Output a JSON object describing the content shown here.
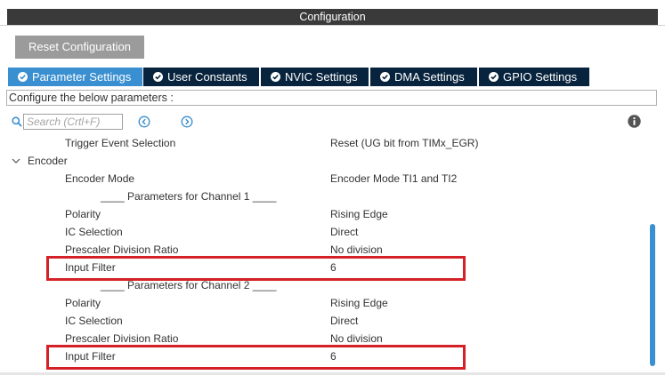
{
  "header": {
    "title": "Configuration"
  },
  "toolbar": {
    "reset_label": "Reset Configuration"
  },
  "tabs": [
    {
      "label": "Parameter Settings",
      "active": true
    },
    {
      "label": "User Constants",
      "active": false
    },
    {
      "label": "NVIC Settings",
      "active": false
    },
    {
      "label": "DMA Settings",
      "active": false
    },
    {
      "label": "GPIO Settings",
      "active": false
    }
  ],
  "description": "Configure the below parameters :",
  "search": {
    "placeholder": "Search (Crtl+F)",
    "value": ""
  },
  "params": {
    "trigger_event_selection": {
      "name": "Trigger Event Selection",
      "value": "Reset (UG bit from TIMx_EGR)"
    },
    "encoder_group": "Encoder",
    "encoder_mode": {
      "name": "Encoder Mode",
      "value": "Encoder Mode TI1 and TI2"
    },
    "channel1_header": "____ Parameters for Channel 1 ____",
    "ch1_polarity": {
      "name": "Polarity",
      "value": "Rising Edge"
    },
    "ch1_ic_selection": {
      "name": "IC Selection",
      "value": "Direct"
    },
    "ch1_prescaler": {
      "name": "Prescaler Division Ratio",
      "value": "No division"
    },
    "ch1_input_filter": {
      "name": "Input Filter",
      "value": "6"
    },
    "channel2_header": "____ Parameters for Channel 2 ____",
    "ch2_polarity": {
      "name": "Polarity",
      "value": "Rising Edge"
    },
    "ch2_ic_selection": {
      "name": "IC Selection",
      "value": "Direct"
    },
    "ch2_prescaler": {
      "name": "Prescaler Division Ratio",
      "value": "No division"
    },
    "ch2_input_filter": {
      "name": "Input Filter",
      "value": "6"
    }
  },
  "colors": {
    "active_tab": "#3a8fd0",
    "inactive_tab": "#08233d",
    "highlight": "#d42027",
    "reset_button": "#9b9b9b"
  },
  "icons": [
    "check-circle-icon",
    "search-icon",
    "prev-arrow-icon",
    "next-arrow-icon",
    "info-icon",
    "chevron-down-icon"
  ]
}
